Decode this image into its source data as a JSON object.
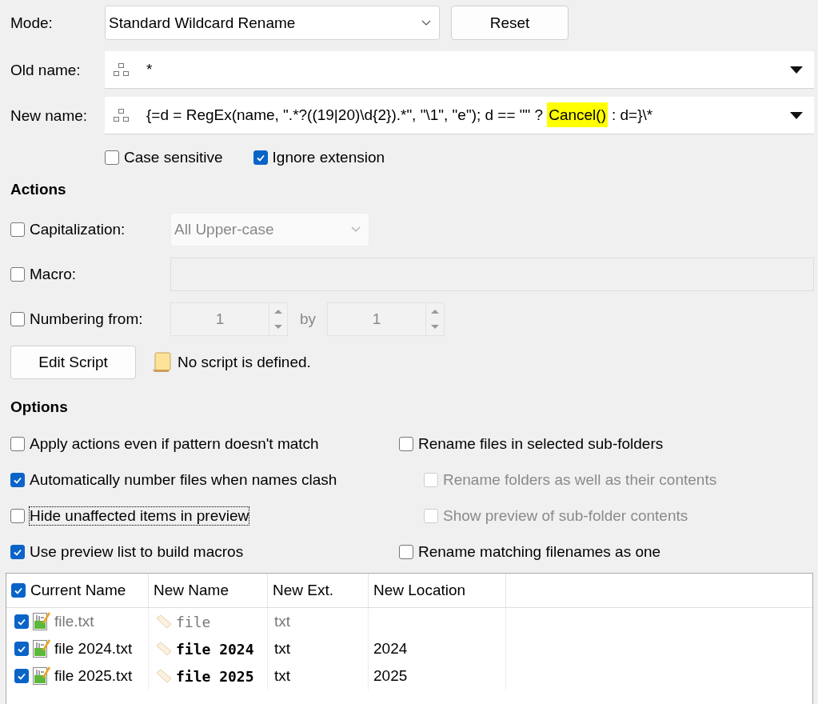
{
  "mode": {
    "label": "Mode:",
    "value": "Standard Wildcard Rename",
    "reset_button": "Reset"
  },
  "old_name": {
    "label": "Old name:",
    "segments": [
      {
        "text": "*",
        "highlighted": false
      }
    ]
  },
  "new_name": {
    "label": "New name:",
    "segments": [
      {
        "text": "{=d = RegEx(name, \".*?((19|20)\\d{2}).*\", \"\\1\", \"e\"); d == \"\" ?",
        "highlighted": false
      },
      {
        "text": "Cancel()",
        "highlighted": true
      },
      {
        "text": ": d=}\\*",
        "highlighted": false
      }
    ]
  },
  "name_options": [
    {
      "label": "Case sensitive",
      "checked": false
    },
    {
      "label": "Ignore extension",
      "checked": true
    }
  ],
  "actions": {
    "heading": "Actions",
    "capitalization": {
      "label": "Capitalization:",
      "checked": false,
      "value": "All Upper-case"
    },
    "macro": {
      "label": "Macro:",
      "checked": false
    },
    "numbering": {
      "label": "Numbering from:",
      "checked": false,
      "from": "1",
      "by_label": "by",
      "by": "1"
    },
    "edit_script_button": "Edit Script",
    "script_status": "No script is defined."
  },
  "options": {
    "heading": "Options",
    "left": [
      {
        "label": "Apply actions even if pattern doesn't match",
        "checked": false,
        "disabled": false,
        "focused": false,
        "kind": "main"
      },
      {
        "label": "Automatically number files when names clash",
        "checked": true,
        "disabled": false,
        "focused": false,
        "kind": "main"
      },
      {
        "label": "Hide unaffected items in preview",
        "checked": false,
        "disabled": false,
        "focused": true,
        "kind": "main"
      },
      {
        "label": "Use preview list to build macros",
        "checked": true,
        "disabled": false,
        "focused": false,
        "kind": "main"
      }
    ],
    "right": [
      {
        "label": "Rename files in selected sub-folders",
        "checked": false,
        "disabled": false,
        "focused": false,
        "kind": "main"
      },
      {
        "label": "Rename folders as well as their contents",
        "checked": false,
        "disabled": true,
        "focused": false,
        "kind": "sub"
      },
      {
        "label": "Show preview of sub-folder contents",
        "checked": false,
        "disabled": true,
        "focused": false,
        "kind": "sub"
      },
      {
        "label": "Rename matching filenames as one",
        "checked": false,
        "disabled": false,
        "focused": false,
        "kind": "main"
      }
    ]
  },
  "preview": {
    "all_checked": true,
    "columns": [
      "Current Name",
      "New Name",
      "New Ext.",
      "New Location"
    ],
    "rows": [
      {
        "checked": true,
        "dimmed": true,
        "current_name": "file.txt",
        "new_name": "file",
        "new_ext": "txt",
        "new_location": ""
      },
      {
        "checked": true,
        "dimmed": false,
        "current_name": "file 2024.txt",
        "new_name": "file 2024",
        "new_ext": "txt",
        "new_location": "2024"
      },
      {
        "checked": true,
        "dimmed": false,
        "current_name": "file 2025.txt",
        "new_name": "file 2025",
        "new_ext": "txt",
        "new_location": "2025"
      }
    ]
  }
}
